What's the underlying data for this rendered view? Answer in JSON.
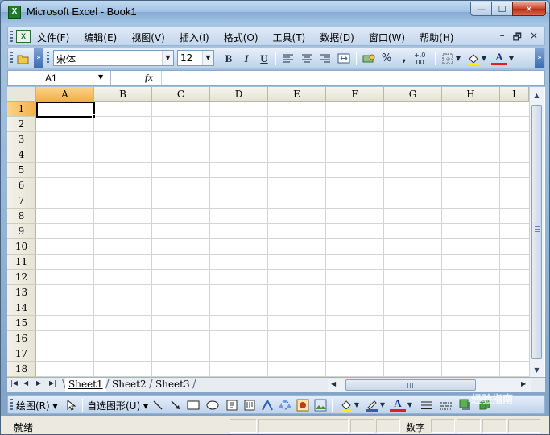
{
  "window": {
    "title": "Microsoft Excel - Book1",
    "app_icon": "X",
    "minimize_icon": "—",
    "maximize_icon": "☐",
    "close_icon": "✕"
  },
  "menubar": {
    "items": [
      {
        "label": "文件(F)"
      },
      {
        "label": "编辑(E)"
      },
      {
        "label": "视图(V)"
      },
      {
        "label": "插入(I)"
      },
      {
        "label": "格式(O)"
      },
      {
        "label": "工具(T)"
      },
      {
        "label": "数据(D)"
      },
      {
        "label": "窗口(W)"
      },
      {
        "label": "帮助(H)"
      }
    ],
    "doc_min_icon": "–",
    "doc_restore_icon": "🗗",
    "doc_close_icon": "×"
  },
  "toolbar": {
    "font_name": "宋体",
    "font_size": "12",
    "bold": "B",
    "italic": "I",
    "underline": "U",
    "percent": "%",
    "comma": ",",
    "decimal": "+.0 .00",
    "font_color_letter": "A",
    "font_color": "#e0201c",
    "fill_color": "#ffee00"
  },
  "formulabar": {
    "name_box": "A1",
    "fx_label": "fx",
    "formula_value": ""
  },
  "grid": {
    "columns": [
      "A",
      "B",
      "C",
      "D",
      "E",
      "F",
      "G",
      "H",
      "I"
    ],
    "rows": [
      "1",
      "2",
      "3",
      "4",
      "5",
      "6",
      "7",
      "8",
      "9",
      "10",
      "11",
      "12",
      "13",
      "14",
      "15",
      "16",
      "17",
      "18"
    ],
    "active_cell": "A1"
  },
  "sheets": {
    "tabs": [
      {
        "label": "Sheet1",
        "active": true
      },
      {
        "label": "Sheet2",
        "active": false
      },
      {
        "label": "Sheet3",
        "active": false
      }
    ],
    "hscroll_grip": "III"
  },
  "drawbar": {
    "draw_label": "绘图(R)",
    "autoshapes_label": "自选图形(U)",
    "font_color_letter": "A"
  },
  "statusbar": {
    "status": "就绪",
    "mode": "数字"
  },
  "watermark": "经验指南"
}
